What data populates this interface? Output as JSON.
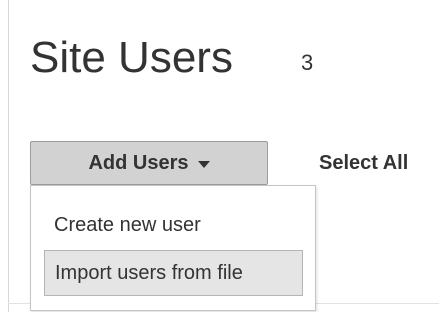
{
  "header": {
    "title": "Site Users",
    "count": "3"
  },
  "toolbar": {
    "add_users_label": "Add Users",
    "select_all_label": "Select All"
  },
  "dropdown": {
    "items": [
      {
        "label": "Create new user",
        "highlighted": false
      },
      {
        "label": "Import users from file",
        "highlighted": true
      }
    ]
  },
  "icons": {
    "add_users_caret": "caret-down-icon"
  },
  "colors": {
    "button_background": "#d2d2d2",
    "menu_highlight": "#e5e5e5",
    "text": "#333333"
  }
}
